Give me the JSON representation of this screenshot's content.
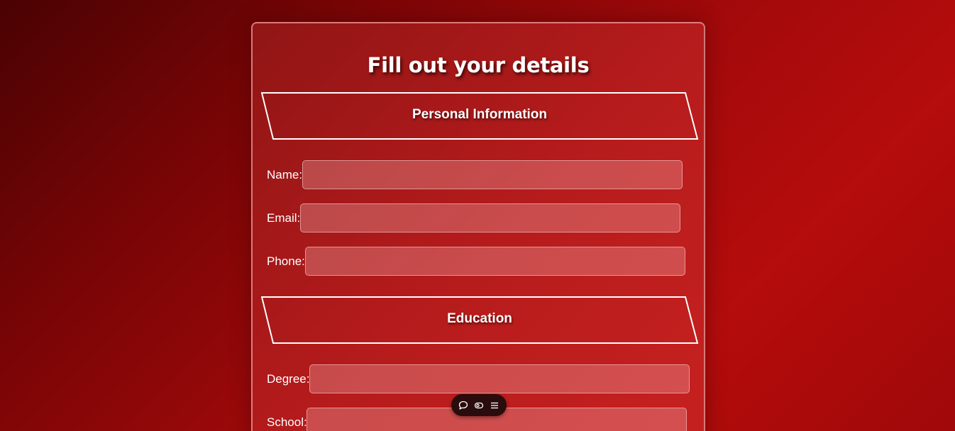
{
  "form": {
    "title": "Fill out your details",
    "sections": {
      "personal": {
        "heading": "Personal Information",
        "name_label": "Name:",
        "name_value": "",
        "email_label": "Email:",
        "email_value": "",
        "phone_label": "Phone:",
        "phone_value": ""
      },
      "education": {
        "heading": "Education",
        "degree_label": "Degree:",
        "degree_value": "",
        "school_label": "School:",
        "school_value": ""
      }
    }
  },
  "toolbar": {
    "icons": [
      "comment-icon",
      "view-icon",
      "menu-icon"
    ]
  },
  "colors": {
    "background_dark": "#4a0203",
    "background_light": "#b50c0c",
    "card_fill": "#b91e1e",
    "text": "#ffffff",
    "toolbar_bg": "#2a0c0c"
  }
}
